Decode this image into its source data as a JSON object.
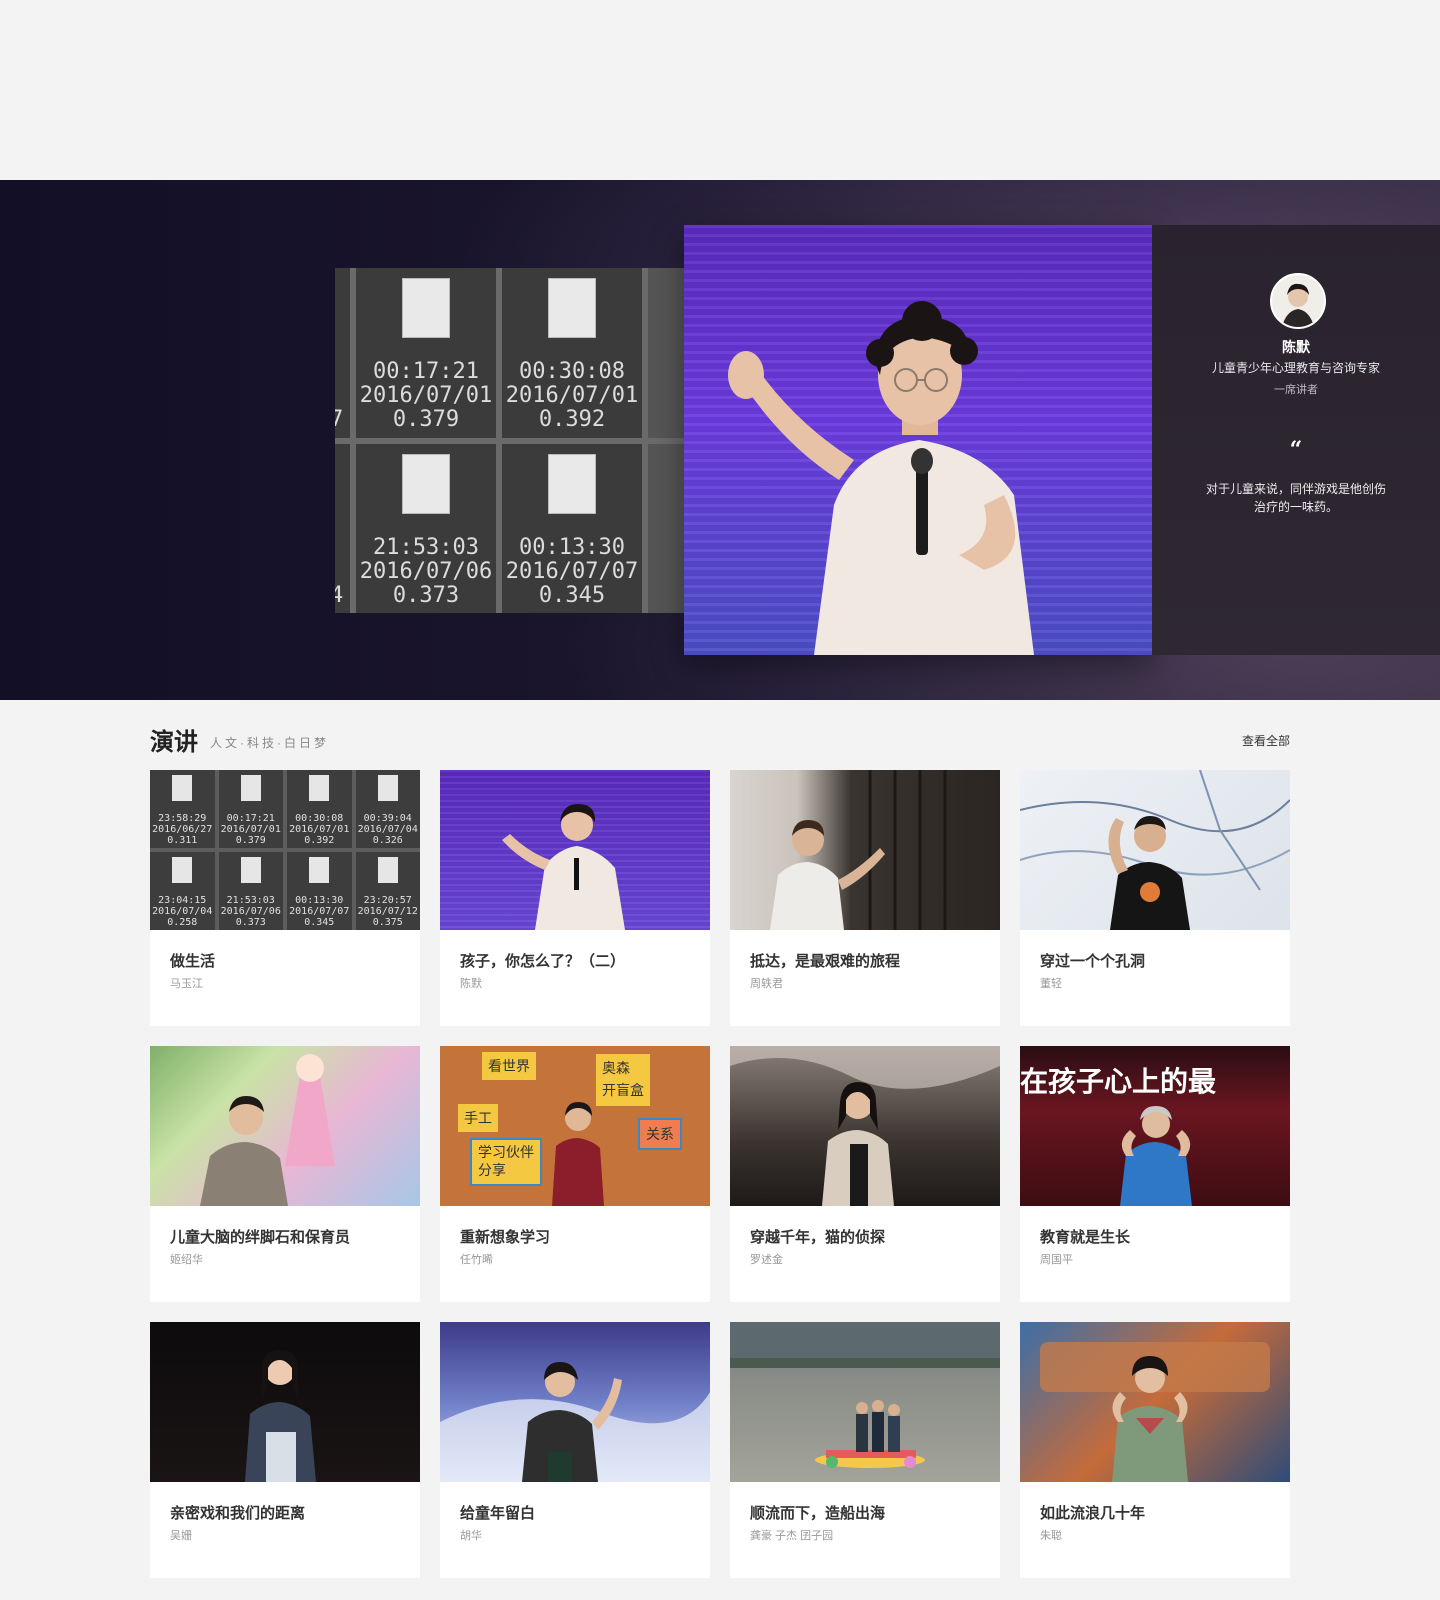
{
  "hero": {
    "prev_slide": {
      "cells": [
        {
          "time": "00:17:21",
          "date": "2016/07/01",
          "value": "0.379"
        },
        {
          "time": "00:30:08",
          "date": "2016/07/01",
          "value": "0.392"
        },
        {
          "time": "21:53:03",
          "date": "2016/07/06",
          "value": "0.373"
        },
        {
          "time": "00:13:30",
          "date": "2016/07/07",
          "value": "0.345"
        }
      ],
      "edge": [
        "27",
        "04"
      ]
    },
    "speaker_name": "陈默",
    "speaker_title": "儿童青少年心理教育与咨询专家",
    "speaker_role": "一席讲者",
    "quote_mark": "“",
    "quote": "对于儿童来说，同伴游戏是他创伤治疗的一味药。"
  },
  "section": {
    "title": "演讲",
    "subtitle": "人文·科技·白日梦",
    "view_all": "查看全部"
  },
  "talks": [
    {
      "title": "做生活",
      "speaker": "马玉江"
    },
    {
      "title": "孩子，你怎么了？（二）",
      "speaker": "陈默"
    },
    {
      "title": "抵达，是最艰难的旅程",
      "speaker": "周轶君"
    },
    {
      "title": "穿过一个个孔洞",
      "speaker": "董轻"
    },
    {
      "title": "儿童大脑的绊脚石和保育员",
      "speaker": "姬绍华"
    },
    {
      "title": "重新想象学习",
      "speaker": "任竹晞"
    },
    {
      "title": "穿越千年，猫的侦探",
      "speaker": "罗述金"
    },
    {
      "title": "教育就是生长",
      "speaker": "周国平"
    },
    {
      "title": "亲密戏和我们的距离",
      "speaker": "吴姗"
    },
    {
      "title": "给童年留白",
      "speaker": "胡华"
    },
    {
      "title": "顺流而下，造船出海",
      "speaker": "龚豪 子杰 囝子园"
    },
    {
      "title": "如此流浪几十年",
      "speaker": "朱聪"
    }
  ],
  "thumb1_cells": [
    {
      "time": "23:58:29",
      "date": "2016/06/27",
      "value": "0.311"
    },
    {
      "time": "00:17:21",
      "date": "2016/07/01",
      "value": "0.379"
    },
    {
      "time": "00:30:08",
      "date": "2016/07/01",
      "value": "0.392"
    },
    {
      "time": "00:39:04",
      "date": "2016/07/04",
      "value": "0.326"
    },
    {
      "time": "23:04:15",
      "date": "2016/07/04",
      "value": "0.258"
    },
    {
      "time": "21:53:03",
      "date": "2016/07/06",
      "value": "0.373"
    },
    {
      "time": "00:13:30",
      "date": "2016/07/07",
      "value": "0.345"
    },
    {
      "time": "23:20:57",
      "date": "2016/07/12",
      "value": "0.375"
    }
  ],
  "thumb_texts": {
    "sticky": [
      "看世界",
      "奥森\n开盲盒",
      "手工",
      "学习伙伴\n分享",
      "关系"
    ],
    "banner": "在孩子心上的最"
  }
}
